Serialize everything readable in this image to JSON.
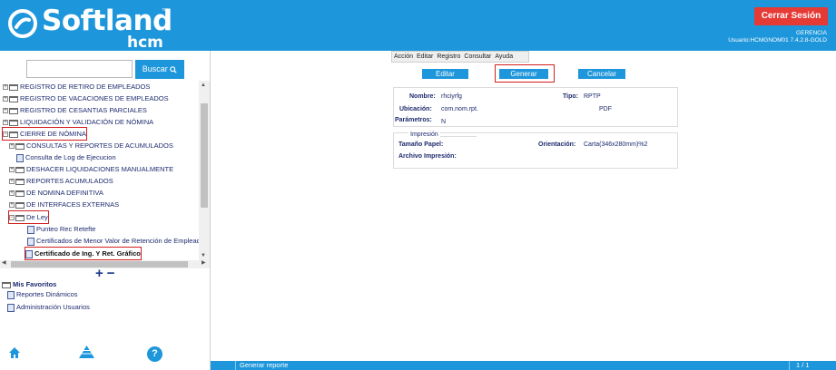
{
  "header": {
    "brand": "Softland",
    "brand_tm": "™",
    "brand_sub": "hcm",
    "logout_label": "Cerrar Sesión",
    "company": "GERENCIA",
    "user": "Usuario:HCMGNOM01 7.4.2.8-GOLD"
  },
  "sidebar": {
    "search_button": "Buscar",
    "tree": [
      {
        "label": "REGISTRO DE RETIRO DE EMPLEADOS"
      },
      {
        "label": "REGISTRO DE VACACIONES DE EMPLEADOS"
      },
      {
        "label": "REGISTRO DE CESANTIAS PARCIALES"
      },
      {
        "label": "LIQUIDACIÓN Y VALIDACIÓN DE NÓMINA"
      },
      {
        "label": "CIERRE DE NÓMINA"
      },
      {
        "label": "CONSULTAS Y REPORTES DE ACUMULADOS"
      },
      {
        "label": "Consulta de Log de Ejecucion"
      },
      {
        "label": "DESHACER LIQUIDACIONES MANUALMENTE"
      },
      {
        "label": "REPORTES ACUMULADOS"
      },
      {
        "label": "DE NOMINA DEFINITIVA"
      },
      {
        "label": "DE INTERFACES EXTERNAS"
      },
      {
        "label": "De Ley"
      },
      {
        "label": "Punteo Rec Retefte"
      },
      {
        "label": "Certificados de Menor Valor de Retención de Empleado"
      },
      {
        "label": "Certificado de Ing. Y Ret. Gráfico"
      }
    ],
    "favorites_title": "Mis Favoritos",
    "favorites": [
      "Reportes Dinámicos",
      "Administración Usuarios"
    ]
  },
  "menu": [
    "Acción",
    "Editar",
    "Registro",
    "Consultar",
    "Ayuda"
  ],
  "actions": {
    "edit": "Editar",
    "generate": "Generar",
    "cancel": "Cancelar"
  },
  "report": {
    "name_label": "Nombre:",
    "name_value": "rhciyrfg",
    "type_label": "Tipo:",
    "type_value": "RPTP",
    "location_label": "Ubicación:",
    "location_value": "com.nom.rpt.",
    "format_value": "PDF",
    "params_label": "Parámetros:",
    "params_value": "N"
  },
  "print": {
    "legend": "Impresión",
    "paper_label": "Tamaño Papel:",
    "orientation_label": "Orientación:",
    "orientation_value": "Carta(346x280mm)%2",
    "file_label": "Archivo Impresión:"
  },
  "status": {
    "message": "Generar reporte",
    "pages": "1 / 1"
  },
  "colors": {
    "brand": "#1d96db",
    "logout": "#e63a35",
    "highlight": "#d21f1f"
  }
}
